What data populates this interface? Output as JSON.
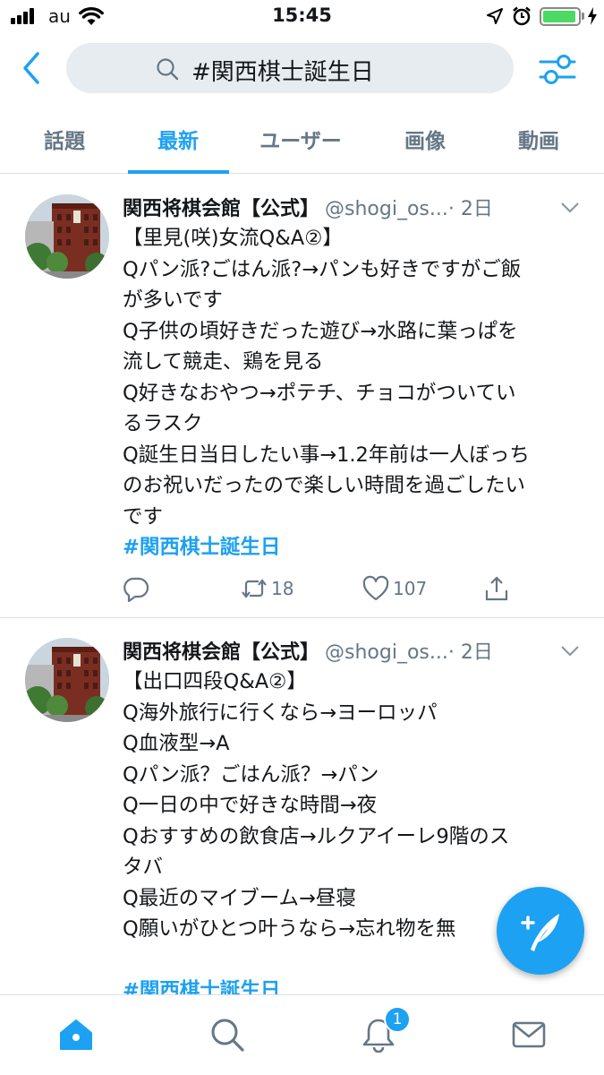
{
  "status_bar": {
    "carrier": "au",
    "time": "15:45",
    "battery_level": 0.95
  },
  "search": {
    "query": "#関西棋士誕生日"
  },
  "tabs": [
    {
      "label": "話題"
    },
    {
      "label": "最新"
    },
    {
      "label": "ユーザー"
    },
    {
      "label": "画像"
    },
    {
      "label": "動画"
    }
  ],
  "active_tab": "最新",
  "tweets": [
    {
      "name": "関西将棋会館【公式】",
      "handle": "@shogi_os...",
      "time": "· 2日",
      "lines": [
        "【里見(咲)女流Q&A②】",
        "Qパン派?ごはん派?→パンも好きですがご飯",
        "が多いです",
        "Q子供の頃好きだった遊び→水路に葉っぱを",
        "流して競走、鶏を見る",
        "Q好きなおやつ→ポテチ、チョコがついてい",
        "るラスク",
        "Q誕生日当日したい事→1.2年前は一人ぼっち",
        "のお祝いだったので楽しい時間を過ごしたい",
        "です"
      ],
      "hashtag": "#関西棋士誕生日",
      "retweets": "18",
      "likes": "107"
    },
    {
      "name": "関西将棋会館【公式】",
      "handle": "@shogi_os...",
      "time": "· 2日",
      "lines": [
        "【出口四段Q&A②】",
        "Q海外旅行に行くなら→ヨーロッパ",
        "Q血液型→A",
        "Qパン派？ごはん派？→パン",
        "Q一日の中で好きな時間→夜",
        "Qおすすめの飲食店→ルクアイーレ9階のス",
        "タバ",
        "Q最近のマイブーム→昼寝",
        "Q願いがひとつ叶うなら→忘れ物を無"
      ],
      "hashtag": "#関西棋士誕生日"
    }
  ],
  "notifications_badge": "1",
  "colors": {
    "accent": "#1da1f2",
    "secondary_text": "#657786",
    "search_bg": "#e6ecf0"
  }
}
